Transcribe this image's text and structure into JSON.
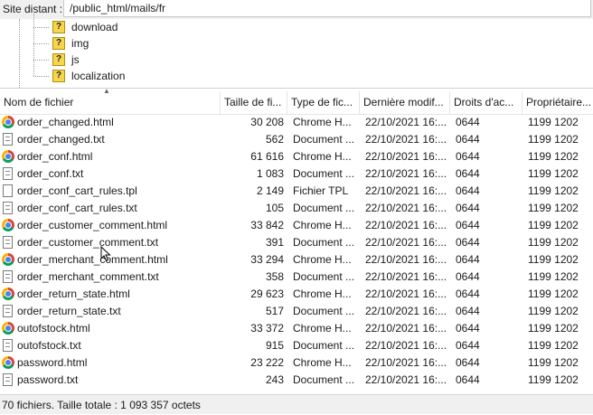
{
  "site": {
    "label": "Site distant :",
    "path": "/public_html/mails/fr"
  },
  "tree": {
    "folders": [
      "download",
      "img",
      "js",
      "localization"
    ],
    "folder_icon": "question-mark-folder-icon"
  },
  "columns": [
    {
      "label": "Nom de fichier"
    },
    {
      "label": "Taille de fi..."
    },
    {
      "label": "Type de fic..."
    },
    {
      "label": "Dernière modif..."
    },
    {
      "label": "Droits d'ac..."
    },
    {
      "label": "Propriétaire..."
    }
  ],
  "files": [
    {
      "name": "order_changed.html",
      "size": "30 208",
      "type": "Chrome H...",
      "date": "22/10/2021 16:...",
      "perm": "0644",
      "owner": "1199 1202",
      "icon": "chrome-icon"
    },
    {
      "name": "order_changed.txt",
      "size": "562",
      "type": "Document ...",
      "date": "22/10/2021 16:...",
      "perm": "0644",
      "owner": "1199 1202",
      "icon": "text-document-icon"
    },
    {
      "name": "order_conf.html",
      "size": "61 616",
      "type": "Chrome H...",
      "date": "22/10/2021 16:...",
      "perm": "0644",
      "owner": "1199 1202",
      "icon": "chrome-icon"
    },
    {
      "name": "order_conf.txt",
      "size": "1 083",
      "type": "Document ...",
      "date": "22/10/2021 16:...",
      "perm": "0644",
      "owner": "1199 1202",
      "icon": "text-document-icon"
    },
    {
      "name": "order_conf_cart_rules.tpl",
      "size": "2 149",
      "type": "Fichier TPL",
      "date": "22/10/2021 16:...",
      "perm": "0644",
      "owner": "1199 1202",
      "icon": "blank-file-icon"
    },
    {
      "name": "order_conf_cart_rules.txt",
      "size": "105",
      "type": "Document ...",
      "date": "22/10/2021 16:...",
      "perm": "0644",
      "owner": "1199 1202",
      "icon": "text-document-icon"
    },
    {
      "name": "order_customer_comment.html",
      "size": "33 842",
      "type": "Chrome H...",
      "date": "22/10/2021 16:...",
      "perm": "0644",
      "owner": "1199 1202",
      "icon": "chrome-icon"
    },
    {
      "name": "order_customer_comment.txt",
      "size": "391",
      "type": "Document ...",
      "date": "22/10/2021 16:...",
      "perm": "0644",
      "owner": "1199 1202",
      "icon": "text-document-icon"
    },
    {
      "name": "order_merchant_comment.html",
      "size": "33 294",
      "type": "Chrome H...",
      "date": "22/10/2021 16:...",
      "perm": "0644",
      "owner": "1199 1202",
      "icon": "chrome-icon"
    },
    {
      "name": "order_merchant_comment.txt",
      "size": "358",
      "type": "Document ...",
      "date": "22/10/2021 16:...",
      "perm": "0644",
      "owner": "1199 1202",
      "icon": "text-document-icon"
    },
    {
      "name": "order_return_state.html",
      "size": "29 623",
      "type": "Chrome H...",
      "date": "22/10/2021 16:...",
      "perm": "0644",
      "owner": "1199 1202",
      "icon": "chrome-icon"
    },
    {
      "name": "order_return_state.txt",
      "size": "517",
      "type": "Document ...",
      "date": "22/10/2021 16:...",
      "perm": "0644",
      "owner": "1199 1202",
      "icon": "text-document-icon"
    },
    {
      "name": "outofstock.html",
      "size": "33 372",
      "type": "Chrome H...",
      "date": "22/10/2021 16:...",
      "perm": "0644",
      "owner": "1199 1202",
      "icon": "chrome-icon"
    },
    {
      "name": "outofstock.txt",
      "size": "915",
      "type": "Document ...",
      "date": "22/10/2021 16:...",
      "perm": "0644",
      "owner": "1199 1202",
      "icon": "text-document-icon"
    },
    {
      "name": "password.html",
      "size": "23 222",
      "type": "Chrome H...",
      "date": "22/10/2021 16:...",
      "perm": "0644",
      "owner": "1199 1202",
      "icon": "chrome-icon"
    },
    {
      "name": "password.txt",
      "size": "243",
      "type": "Document ...",
      "date": "22/10/2021 16:...",
      "perm": "0644",
      "owner": "1199 1202",
      "icon": "text-document-icon"
    }
  ],
  "status": "70 fichiers. Taille totale : 1 093 357 octets"
}
